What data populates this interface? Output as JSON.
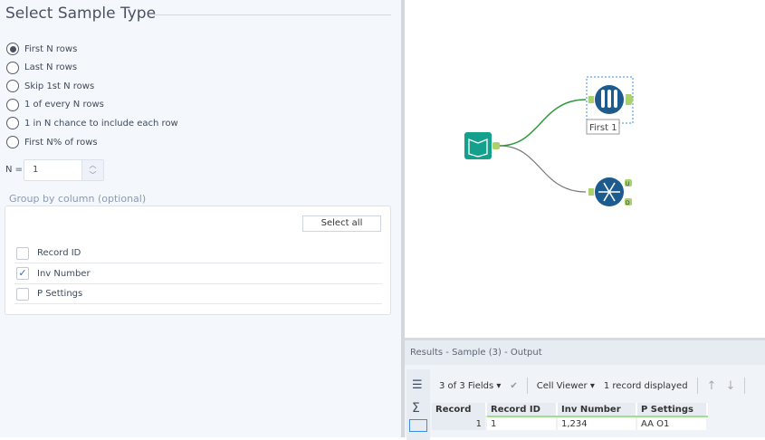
{
  "config": {
    "title": "Select Sample Type",
    "options": [
      {
        "label": "First N rows",
        "selected": true
      },
      {
        "label": "Last N rows",
        "selected": false
      },
      {
        "label": "Skip 1st N rows",
        "selected": false
      },
      {
        "label": "1 of every N rows",
        "selected": false
      },
      {
        "label": "1 in N chance to include each row",
        "selected": false
      },
      {
        "label": "First N% of rows",
        "selected": false
      }
    ],
    "n_label": "N =",
    "n_value": "1",
    "group_label": "Group by column (optional)",
    "select_all": "Select all",
    "columns": [
      {
        "label": "Record ID",
        "checked": false
      },
      {
        "label": "Inv Number",
        "checked": true
      },
      {
        "label": "P Settings",
        "checked": false
      }
    ]
  },
  "canvas": {
    "sample_label": "First 1",
    "unique_ports": [
      "U",
      "D"
    ]
  },
  "results": {
    "title": "Results - Sample (3) - Output",
    "fields": "3 of 3 Fields",
    "viewer": "Cell Viewer",
    "records": "1 record displayed",
    "headers": [
      "Record",
      "Record ID",
      "Inv Number",
      "P Settings"
    ],
    "rows": [
      [
        "1",
        "1",
        "1,234",
        "AA O1"
      ]
    ]
  },
  "colors": {
    "accent_green": "#9fe08a",
    "tool_blue": "#1d5b8f",
    "tool_teal": "#14a08c"
  }
}
